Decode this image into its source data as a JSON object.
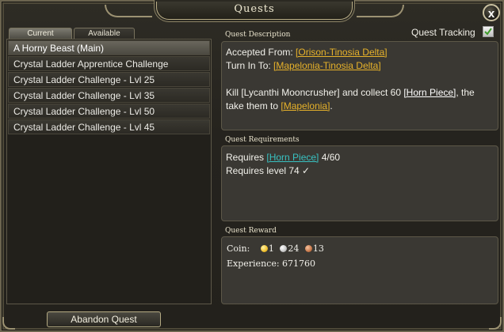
{
  "window": {
    "title": "Quests",
    "close_label": "x"
  },
  "tabs": [
    {
      "label": "Current"
    },
    {
      "label": "Available"
    }
  ],
  "quests": [
    {
      "label": "A Horny Beast (Main)"
    },
    {
      "label": "Crystal Ladder Apprentice Challenge"
    },
    {
      "label": "Crystal Ladder Challenge - Lvl 25"
    },
    {
      "label": "Crystal Ladder Challenge - Lvl 35"
    },
    {
      "label": "Crystal Ladder Challenge - Lvl 50"
    },
    {
      "label": "Crystal Ladder Challenge - Lvl 45"
    }
  ],
  "abandon_label": "Abandon Quest",
  "tracking": {
    "label": "Quest Tracking",
    "checked": true
  },
  "description": {
    "heading": "Quest Description",
    "accepted_prefix": "Accepted From: ",
    "accepted_link": "[Orison-Tinosia Delta]",
    "turnin_prefix": "Turn In To: ",
    "turnin_link": "[Mapelonia-Tinosia Delta]",
    "body_kill": "Kill [Lycanthi Mooncrusher] and collect 60 ",
    "body_item": "[Horn Piece]",
    "body_after": ", the",
    "body_line2_prefix": "take them to ",
    "body_line2_link": "[Mapelonia]",
    "body_line2_suffix": "."
  },
  "requirements": {
    "heading": "Quest Requirements",
    "req1_prefix": "Requires ",
    "req1_item": "[Horn Piece]",
    "req1_progress": " 4/60",
    "req2": "Requires level 74  ✓"
  },
  "reward": {
    "heading": "Quest Reward",
    "coin_label": "Coin:",
    "gold": "1",
    "silver": "24",
    "copper": "13",
    "experience": "Experience: 671760"
  },
  "colors": {
    "link_gold": "#e7b22a",
    "link_teal": "#38c2c2",
    "coin_gold": "#f2c12e",
    "coin_silver": "#c8c8c8",
    "coin_copper": "#c9794a"
  }
}
